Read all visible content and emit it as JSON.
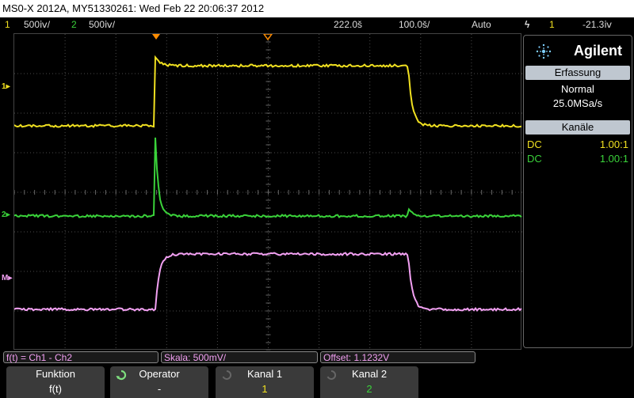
{
  "title": "MS0-X 2012A, MY51330261: Wed Feb 22 20:06:37 2012",
  "status": {
    "ch1_num": "1",
    "ch1_scale": "500ⅳ/",
    "ch2_num": "2",
    "ch2_scale": "500ⅳ/",
    "time_delay": "222.0š",
    "time_scale": "100.0š/",
    "trigger_mode": "Auto",
    "trigger_symbol": "ϟ",
    "trigger_src": "1",
    "trigger_level": "-21.3ⅳ"
  },
  "markers": {
    "ch1": "1",
    "ch2": "2",
    "math": "M"
  },
  "panel": {
    "brand": "Agilent",
    "acq_header": "Erfassung",
    "acq_mode": "Normal",
    "acq_rate": "25.0MSa/s",
    "ch_header": "Kanäle",
    "ch_rows": [
      {
        "coupling": "DC",
        "probe": "1.00:1",
        "color": "#f0e020"
      },
      {
        "coupling": "DC",
        "probe": "1.00:1",
        "color": "#3ad23a"
      }
    ]
  },
  "softbar": {
    "function": "f(t) = Ch1 - Ch2",
    "scale": "Skala: 500mV/",
    "offset": "Offset: 1.1232V"
  },
  "softkeys": [
    {
      "label": "Funktion",
      "value": "f(t)"
    },
    {
      "label": "Operator",
      "value": "-"
    },
    {
      "label": "Kanal 1",
      "value": "1"
    },
    {
      "label": "Kanal 2",
      "value": "2"
    }
  ],
  "colors": {
    "ch1": "#f0e020",
    "ch2": "#3ad23a",
    "math": "#f2a0f2",
    "grid": "#5a5a5a",
    "trigger_marker": "#ff8c00"
  }
}
